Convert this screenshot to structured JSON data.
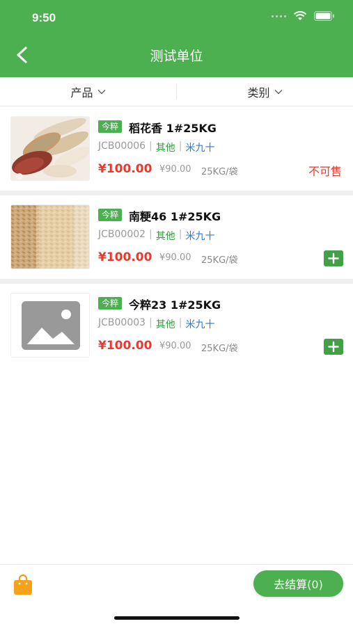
{
  "status": {
    "time": "9:50"
  },
  "header": {
    "title": "测试单位"
  },
  "filters": [
    {
      "label": "产品"
    },
    {
      "label": "类别"
    }
  ],
  "products": [
    {
      "tag": "今粹",
      "name": "稻花香 1#25KG",
      "code": "JCB00006",
      "category": "其他",
      "brand": "米九十",
      "price": "¥100.00",
      "original_price": "¥90.00",
      "unit": "25KG/袋",
      "status": "不可售",
      "image": "rice-scoops-photo"
    },
    {
      "tag": "今粹",
      "name": "南粳46 1#25KG",
      "code": "JCB00002",
      "category": "其他",
      "brand": "米九十",
      "price": "¥100.00",
      "original_price": "¥90.00",
      "unit": "25KG/袋",
      "image": "rice-grains-photo"
    },
    {
      "tag": "今粹",
      "name": "今粹23 1#25KG",
      "code": "JCB00003",
      "category": "其他",
      "brand": "米九十",
      "price": "¥100.00",
      "original_price": "¥90.00",
      "unit": "25KG/袋",
      "image": "image-placeholder"
    }
  ],
  "footer": {
    "checkout_label": "去结算(0)"
  },
  "colors": {
    "primary": "#4caf50",
    "price": "#e23b2f",
    "category": "#2e9f3c",
    "brand": "#2a7ae2"
  }
}
